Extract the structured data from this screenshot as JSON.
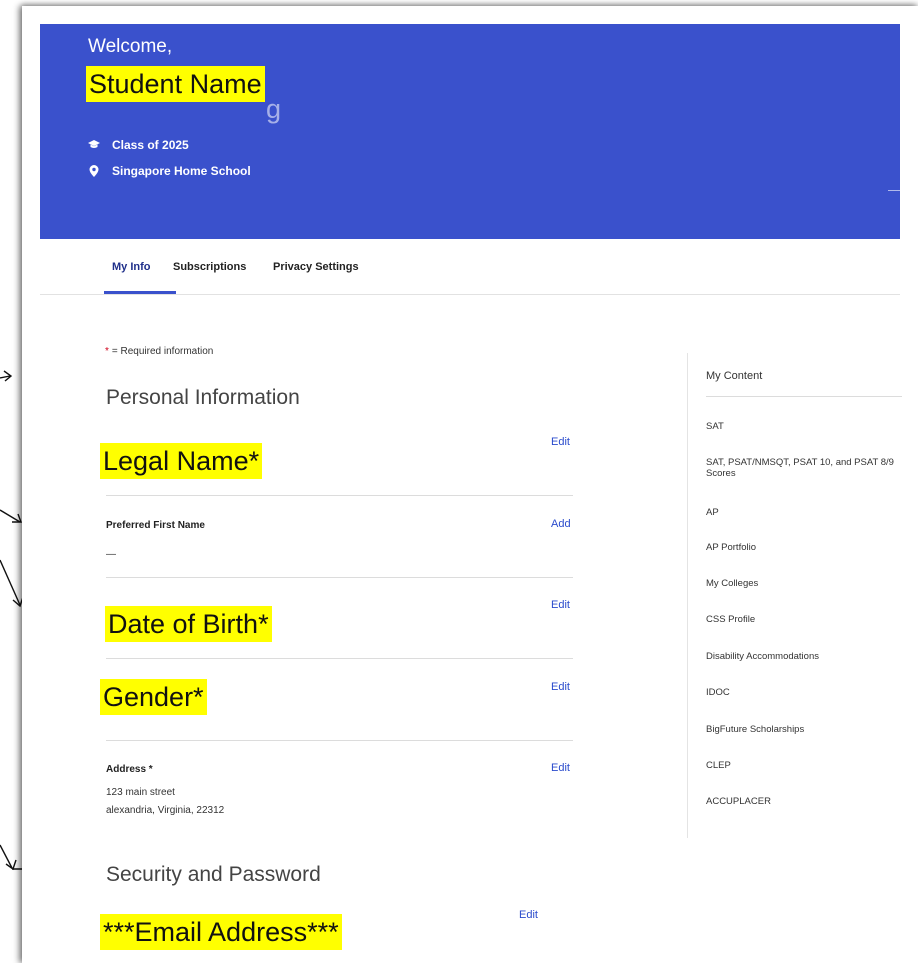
{
  "header": {
    "welcome": "Welcome,",
    "student_name": "Student Name",
    "ghost_fragment": "g",
    "class_year": "Class of 2025",
    "school": "Singapore Home School"
  },
  "tabs": [
    {
      "label": "My Info",
      "active": true
    },
    {
      "label": "Subscriptions",
      "active": false
    },
    {
      "label": "Privacy Settings",
      "active": false
    }
  ],
  "required_note": {
    "star": "*",
    "text": "= Required information"
  },
  "personal": {
    "title": "Personal Information",
    "legal_name": {
      "label": "Legal Name*",
      "action": "Edit"
    },
    "preferred_first_name": {
      "label": "Preferred First Name",
      "value": "—",
      "action": "Add"
    },
    "date_of_birth": {
      "label": "Date of Birth*",
      "action": "Edit"
    },
    "gender": {
      "label": "Gender*",
      "action": "Edit"
    },
    "address": {
      "label": "Address *",
      "line1": "123 main street",
      "line2": "alexandria, Virginia, 22312",
      "action": "Edit"
    }
  },
  "security": {
    "title": "Security and Password",
    "email": {
      "label": "***Email Address***",
      "action": "Edit"
    }
  },
  "sidebar": {
    "title": "My Content",
    "items": [
      "SAT",
      "SAT, PSAT/NMSQT, PSAT 10, and PSAT 8/9 Scores",
      "AP",
      "AP Portfolio",
      "My Colleges",
      "CSS Profile",
      "Disability Accommodations",
      "IDOC",
      "BigFuture Scholarships",
      "CLEP",
      "ACCUPLACER"
    ]
  },
  "colors": {
    "hero": "#3a51cc",
    "highlight": "#ffff00",
    "link": "#2a4bcc",
    "required_star": "#d0021b"
  },
  "icons": {
    "class": "graduation-cap-icon",
    "school": "location-pin-icon"
  }
}
